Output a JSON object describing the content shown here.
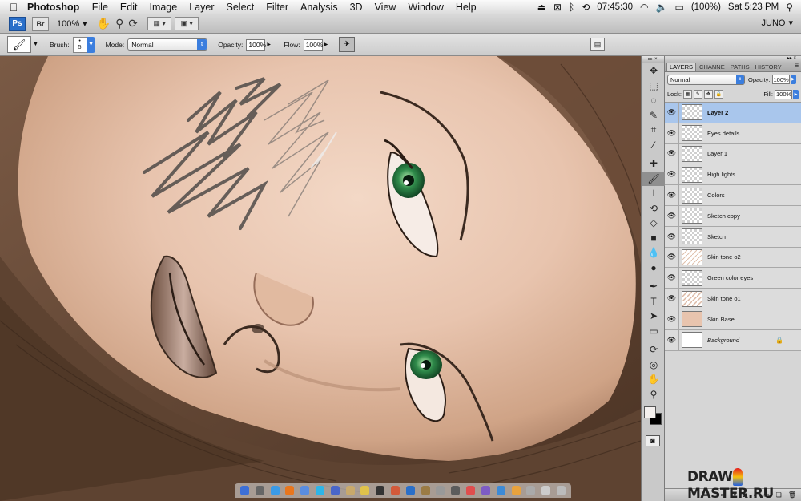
{
  "menubar": {
    "app_name": "Photoshop",
    "items": [
      "File",
      "Edit",
      "Image",
      "Layer",
      "Select",
      "Filter",
      "Analysis",
      "3D",
      "View",
      "Window",
      "Help"
    ],
    "clock_time": "07:45:30",
    "battery": "(100%)",
    "datetime": "Sat 5:23 PM"
  },
  "appbar": {
    "ps_label": "Ps",
    "br_label": "Br",
    "zoom": "100%",
    "workspace": "JUNO"
  },
  "options": {
    "brush_label": "Brush:",
    "brush_size": "5",
    "mode_label": "Mode:",
    "mode_value": "Normal",
    "opacity_label": "Opacity:",
    "opacity_value": "100%",
    "flow_label": "Flow:",
    "flow_value": "100%"
  },
  "layers_panel": {
    "tabs": [
      "LAYERS",
      "CHANNE",
      "PATHS",
      "HISTORY"
    ],
    "blend_mode": "Normal",
    "opacity_label": "Opacity:",
    "opacity_value": "100%",
    "lock_label": "Lock:",
    "fill_label": "Fill:",
    "fill_value": "100%",
    "layers": [
      {
        "name": "Layer 2",
        "selected": true
      },
      {
        "name": "Eyes details"
      },
      {
        "name": "Layer 1"
      },
      {
        "name": "High lights"
      },
      {
        "name": "Colors"
      },
      {
        "name": "Sketch copy"
      },
      {
        "name": "Sketch"
      },
      {
        "name": "Skin tone o2"
      },
      {
        "name": "Green color eyes"
      },
      {
        "name": "Skin tone o1"
      },
      {
        "name": "Skin Base"
      },
      {
        "name": "Background",
        "locked": true
      }
    ]
  },
  "watermark": {
    "left": "DRAW",
    "right": "MASTER.RU"
  },
  "colors": {
    "skin": "#e8c4ae",
    "hair": "#5e4331",
    "eye_green": "#2f8a4a",
    "selection": "#a9c6ec",
    "accent": "#3b7ede"
  }
}
